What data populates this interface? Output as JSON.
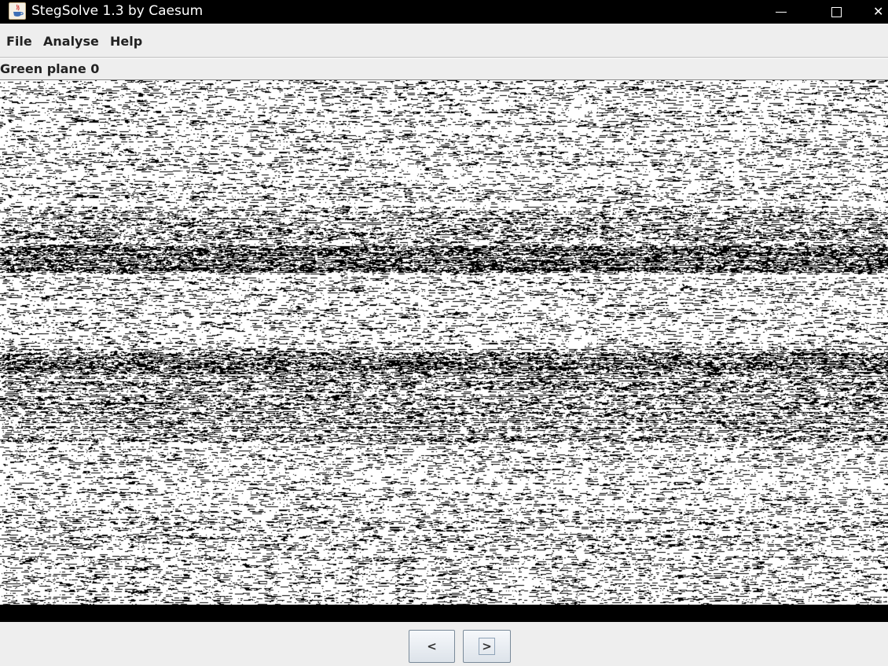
{
  "window": {
    "title": "StegSolve 1.3 by Caesum",
    "controls": {
      "minimize": "minimize-icon",
      "maximize": "maximize-icon",
      "close": "close-icon"
    }
  },
  "menu": {
    "file": "File",
    "analyse": "Analyse",
    "help": "Help"
  },
  "viewer": {
    "plane_label": "Green plane 0",
    "image": "green-plane-0-bit-noise"
  },
  "navigation": {
    "prev_label": "<",
    "next_label": ">"
  },
  "colors": {
    "titlebar": "#000000",
    "background": "#eeeeee",
    "image_background": "#ffffff",
    "pixel": "#000000"
  }
}
